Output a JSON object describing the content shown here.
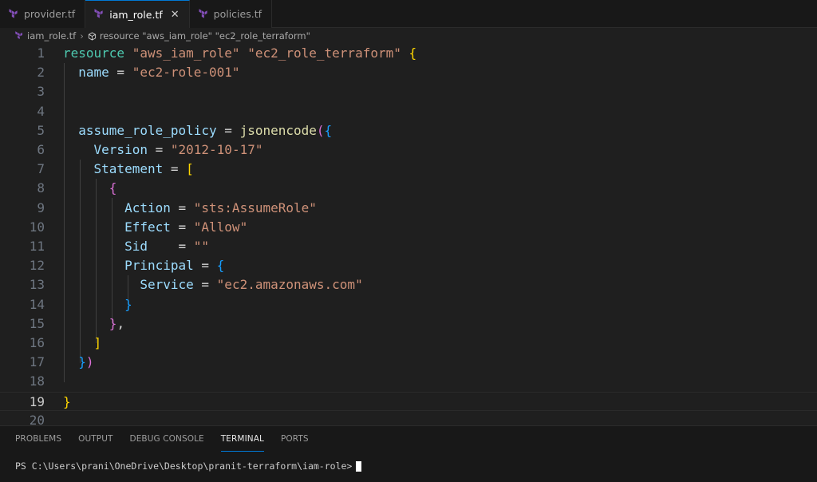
{
  "tabs": [
    {
      "label": "provider.tf",
      "active": false
    },
    {
      "label": "iam_role.tf",
      "active": true,
      "close": "✕"
    },
    {
      "label": "policies.tf",
      "active": false
    }
  ],
  "breadcrumb": {
    "file": "iam_role.tf",
    "symbol": "resource \"aws_iam_role\" \"ec2_role_terraform\""
  },
  "editor": {
    "current_line": 19,
    "lines": [
      {
        "n": "1",
        "t": [
          [
            "kw",
            "resource"
          ],
          [
            "op",
            " "
          ],
          [
            "str",
            "\"aws_iam_role\""
          ],
          [
            "op",
            " "
          ],
          [
            "str",
            "\"ec2_role_terraform\""
          ],
          [
            "op",
            " "
          ],
          [
            "b1",
            "{"
          ]
        ]
      },
      {
        "n": "2",
        "t": [
          [
            "op",
            "  "
          ],
          [
            "attr",
            "name"
          ],
          [
            "op",
            " = "
          ],
          [
            "str",
            "\"ec2-role-001\""
          ]
        ]
      },
      {
        "n": "3",
        "t": []
      },
      {
        "n": "4",
        "t": []
      },
      {
        "n": "5",
        "t": [
          [
            "op",
            "  "
          ],
          [
            "attr",
            "assume_role_policy"
          ],
          [
            "op",
            " = "
          ],
          [
            "fn",
            "jsonencode"
          ],
          [
            "b2",
            "("
          ],
          [
            "b3",
            "{"
          ]
        ]
      },
      {
        "n": "6",
        "t": [
          [
            "op",
            "    "
          ],
          [
            "attr",
            "Version"
          ],
          [
            "op",
            " = "
          ],
          [
            "str",
            "\"2012-10-17\""
          ]
        ]
      },
      {
        "n": "7",
        "t": [
          [
            "op",
            "    "
          ],
          [
            "attr",
            "Statement"
          ],
          [
            "op",
            " = "
          ],
          [
            "b1",
            "["
          ]
        ]
      },
      {
        "n": "8",
        "t": [
          [
            "op",
            "      "
          ],
          [
            "b2",
            "{"
          ]
        ]
      },
      {
        "n": "9",
        "t": [
          [
            "op",
            "        "
          ],
          [
            "attr",
            "Action"
          ],
          [
            "op",
            " = "
          ],
          [
            "str",
            "\"sts:AssumeRole\""
          ]
        ]
      },
      {
        "n": "10",
        "t": [
          [
            "op",
            "        "
          ],
          [
            "attr",
            "Effect"
          ],
          [
            "op",
            " = "
          ],
          [
            "str",
            "\"Allow\""
          ]
        ]
      },
      {
        "n": "11",
        "t": [
          [
            "op",
            "        "
          ],
          [
            "attr",
            "Sid"
          ],
          [
            "op",
            "    = "
          ],
          [
            "str",
            "\"\""
          ]
        ]
      },
      {
        "n": "12",
        "t": [
          [
            "op",
            "        "
          ],
          [
            "attr",
            "Principal"
          ],
          [
            "op",
            " = "
          ],
          [
            "b3",
            "{"
          ]
        ]
      },
      {
        "n": "13",
        "t": [
          [
            "op",
            "          "
          ],
          [
            "attr",
            "Service"
          ],
          [
            "op",
            " = "
          ],
          [
            "str",
            "\"ec2.amazonaws.com\""
          ]
        ]
      },
      {
        "n": "14",
        "t": [
          [
            "op",
            "        "
          ],
          [
            "b3",
            "}"
          ]
        ]
      },
      {
        "n": "15",
        "t": [
          [
            "op",
            "      "
          ],
          [
            "b2",
            "}"
          ],
          [
            "op",
            ","
          ]
        ]
      },
      {
        "n": "16",
        "t": [
          [
            "op",
            "    "
          ],
          [
            "b1",
            "]"
          ]
        ]
      },
      {
        "n": "17",
        "t": [
          [
            "op",
            "  "
          ],
          [
            "b3",
            "}"
          ],
          [
            "b2",
            ")"
          ]
        ]
      },
      {
        "n": "18",
        "t": []
      },
      {
        "n": "19",
        "t": [
          [
            "b1",
            "}"
          ]
        ]
      },
      {
        "n": "20",
        "t": []
      }
    ]
  },
  "panel": {
    "tabs": [
      {
        "label": "PROBLEMS",
        "active": false
      },
      {
        "label": "OUTPUT",
        "active": false
      },
      {
        "label": "DEBUG CONSOLE",
        "active": false
      },
      {
        "label": "TERMINAL",
        "active": true
      },
      {
        "label": "PORTS",
        "active": false
      }
    ],
    "terminal_prompt": "PS C:\\Users\\prani\\OneDrive\\Desktop\\pranit-terraform\\iam-role>"
  },
  "colors": {
    "accent": "#0078d4",
    "terraform_icon": "#844fba"
  }
}
